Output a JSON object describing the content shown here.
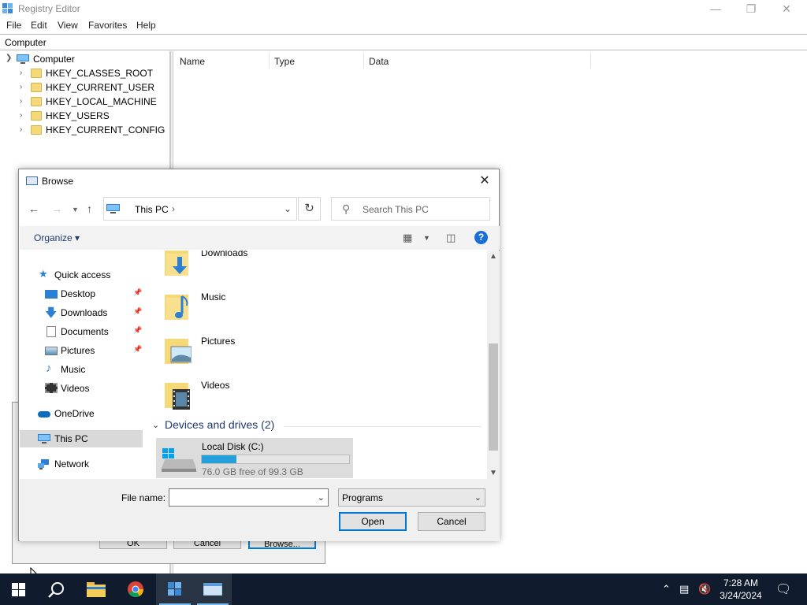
{
  "registry": {
    "title": "Registry Editor",
    "menu": [
      "File",
      "Edit",
      "View",
      "Favorites",
      "Help"
    ],
    "address": "Computer",
    "tree": {
      "root": "Computer",
      "keys": [
        "HKEY_CLASSES_ROOT",
        "HKEY_CURRENT_USER",
        "HKEY_LOCAL_MACHINE",
        "HKEY_USERS",
        "HKEY_CURRENT_CONFIG"
      ]
    },
    "columns": [
      "Name",
      "Type",
      "Data"
    ]
  },
  "background_dialog": {
    "buttons": [
      "OK",
      "Cancel",
      "Browse..."
    ]
  },
  "browse": {
    "title": "Browse",
    "address_location": "This PC",
    "search_placeholder": "Search This PC",
    "organize_label": "Organize",
    "nav": {
      "quick_access": "Quick access",
      "items": [
        "Desktop",
        "Downloads",
        "Documents",
        "Pictures",
        "Music",
        "Videos"
      ],
      "onedrive": "OneDrive",
      "this_pc": "This PC",
      "network": "Network"
    },
    "folders": [
      "Downloads",
      "Music",
      "Pictures",
      "Videos"
    ],
    "devices_header": "Devices and drives (2)",
    "drive": {
      "name": "Local Disk (C:)",
      "free_text": "76.0 GB free of 99.3 GB",
      "used_fraction": 0.235
    },
    "file_name_label": "File name:",
    "file_name_value": "",
    "file_type": "Programs",
    "open_label": "Open",
    "cancel_label": "Cancel"
  },
  "taskbar": {
    "time": "7:28 AM",
    "date": "3/24/2024"
  },
  "colors": {
    "accent": "#0078d7",
    "taskbar": "#101c2e",
    "progress": "#26a0da",
    "selection": "#d9d9d9"
  }
}
